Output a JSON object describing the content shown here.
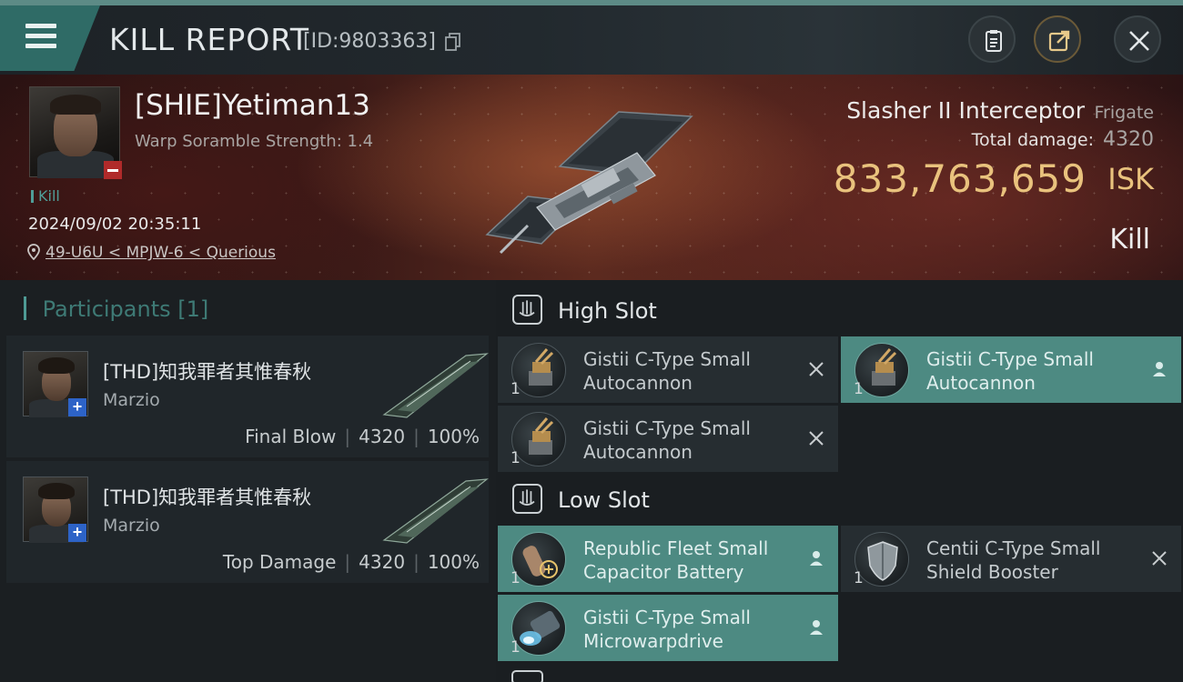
{
  "header": {
    "title": "KILL REPORT",
    "report_id": "[ID:9803363]"
  },
  "victim": {
    "name": "[SHIE]Yetiman13",
    "warp_scramble": "Warp Soramble Strength: 1.4",
    "tag": "Kill",
    "timestamp": "2024/09/02 20:35:11",
    "location": "49-U6U < MPJW-6 < Querious"
  },
  "ship": {
    "name": "Slasher II Interceptor",
    "class": "Frigate",
    "total_damage_label": "Total damage:",
    "total_damage": "4320",
    "isk_value": "833,763,659",
    "isk_unit": "ISK",
    "result": "Kill"
  },
  "participants": {
    "label": "Participants",
    "count": "[1]",
    "rows": [
      {
        "name": "[THD]知我罪者其惟春秋",
        "ship": "Marzio",
        "role": "Final Blow",
        "damage": "4320",
        "percent": "100%"
      },
      {
        "name": "[THD]知我罪者其惟春秋",
        "ship": "Marzio",
        "role": "Top Damage",
        "damage": "4320",
        "percent": "100%"
      }
    ]
  },
  "fitting": {
    "high_slot": {
      "title": "High Slot",
      "modules": [
        {
          "name": "Gistii C-Type Small Autocannon",
          "qty": "1",
          "state": "destroyed",
          "icon": "autocannon-icon"
        },
        {
          "name": "Gistii C-Type Small Autocannon",
          "qty": "1",
          "state": "dropped",
          "icon": "autocannon-icon"
        },
        {
          "name": "Gistii C-Type Small Autocannon",
          "qty": "1",
          "state": "destroyed",
          "icon": "autocannon-icon"
        }
      ]
    },
    "low_slot": {
      "title": "Low Slot",
      "modules": [
        {
          "name": "Republic Fleet Small Capacitor Battery",
          "qty": "1",
          "state": "dropped",
          "icon": "capacitor-battery-icon"
        },
        {
          "name": "Centii C-Type Small Shield Booster",
          "qty": "1",
          "state": "destroyed",
          "icon": "shield-booster-icon"
        },
        {
          "name": "Gistii C-Type Small Microwarpdrive",
          "qty": "1",
          "state": "dropped",
          "icon": "microwarpdrive-icon"
        }
      ]
    }
  },
  "colors": {
    "accent_teal": "#4d8a82",
    "isk_gold": "#e9c27d",
    "kill_red": "#b02a2a",
    "corp_blue": "#2d63c7"
  }
}
